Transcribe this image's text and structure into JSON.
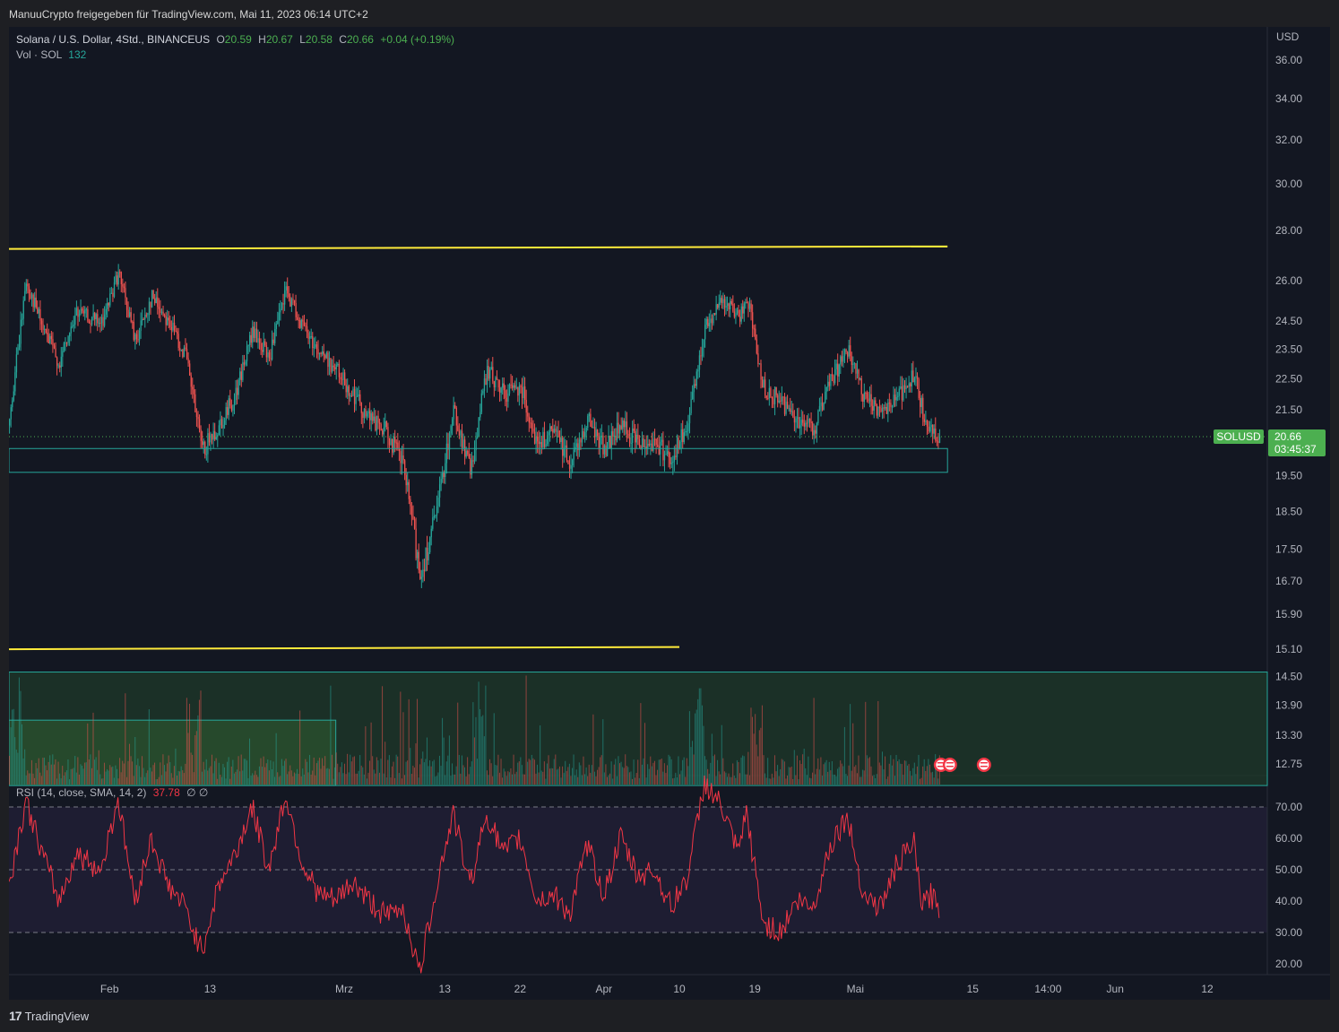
{
  "header": {
    "publish_line": "ManuuCrypto freigegeben für TradingView.com, Mai 11, 2023 06:14 UTC+2"
  },
  "legend": {
    "symbol": "Solana / U.S. Dollar, 4Std., BINANCEUS",
    "o_label": "O",
    "o_value": "20.59",
    "h_label": "H",
    "h_value": "20.67",
    "l_label": "L",
    "l_value": "20.58",
    "c_label": "C",
    "c_value": "20.66",
    "change": "+0.04 (+0.19%)",
    "vol_label": "Vol · SOL",
    "vol_value": "132"
  },
  "rsi_legend": {
    "label": "RSI (14, close, SMA, 14, 2)",
    "value": "37.78",
    "extra": "∅  ∅"
  },
  "price_badge": {
    "symbol": "SOLUSD",
    "price": "20.66",
    "countdown": "03:45:37"
  },
  "footer": {
    "brand": "TradingView"
  },
  "colors": {
    "up": "#26a69a",
    "down": "#ef5350",
    "yellow": "#ffeb3b",
    "rsi": "#f23645",
    "badge": "#4caf50"
  },
  "chart_data": {
    "type": "candlestick",
    "symbol": "Solana / U.S. Dollar",
    "timeframe": "4Std.",
    "exchange": "BINANCEUS",
    "currency": "USD",
    "scale": "log",
    "price_axis_ticks": [
      "36.00",
      "34.00",
      "32.00",
      "30.00",
      "28.00",
      "26.00",
      "24.50",
      "23.50",
      "22.50",
      "21.50",
      "19.50",
      "18.50",
      "17.50",
      "16.70",
      "15.90",
      "15.10",
      "14.50",
      "13.90",
      "13.30",
      "12.75"
    ],
    "rsi_axis_ticks": [
      "70.00",
      "60.00",
      "50.00",
      "40.00",
      "30.00",
      "20.00"
    ],
    "time_axis_ticks": [
      "Feb",
      "13",
      "Mrz",
      "13",
      "22",
      "Apr",
      "10",
      "19",
      "Mai",
      "15",
      "14:00",
      "Jun",
      "12"
    ],
    "last_price": 20.66,
    "path_points": [
      {
        "date": "2023-01-20",
        "price": 21.0
      },
      {
        "date": "2023-01-22",
        "price": 26.0
      },
      {
        "date": "2023-01-24",
        "price": 24.2
      },
      {
        "date": "2023-01-26",
        "price": 23.0
      },
      {
        "date": "2023-01-28",
        "price": 24.8
      },
      {
        "date": "2023-01-31",
        "price": 24.4
      },
      {
        "date": "2023-02-02",
        "price": 26.3
      },
      {
        "date": "2023-02-04",
        "price": 23.8
      },
      {
        "date": "2023-02-06",
        "price": 25.4
      },
      {
        "date": "2023-02-08",
        "price": 24.5
      },
      {
        "date": "2023-02-10",
        "price": 23.3
      },
      {
        "date": "2023-02-12",
        "price": 20.2
      },
      {
        "date": "2023-02-14",
        "price": 21.0
      },
      {
        "date": "2023-02-16",
        "price": 22.0
      },
      {
        "date": "2023-02-18",
        "price": 24.1
      },
      {
        "date": "2023-02-20",
        "price": 23.2
      },
      {
        "date": "2023-02-22",
        "price": 25.6
      },
      {
        "date": "2023-02-24",
        "price": 24.3
      },
      {
        "date": "2023-02-26",
        "price": 23.4
      },
      {
        "date": "2023-02-28",
        "price": 22.8
      },
      {
        "date": "2023-03-02",
        "price": 22.0
      },
      {
        "date": "2023-03-04",
        "price": 21.2
      },
      {
        "date": "2023-03-06",
        "price": 20.8
      },
      {
        "date": "2023-03-08",
        "price": 19.8
      },
      {
        "date": "2023-03-10",
        "price": 16.8
      },
      {
        "date": "2023-03-12",
        "price": 18.5
      },
      {
        "date": "2023-03-14",
        "price": 21.5
      },
      {
        "date": "2023-03-16",
        "price": 19.6
      },
      {
        "date": "2023-03-18",
        "price": 22.8
      },
      {
        "date": "2023-03-20",
        "price": 22.0
      },
      {
        "date": "2023-03-22",
        "price": 22.3
      },
      {
        "date": "2023-03-24",
        "price": 20.4
      },
      {
        "date": "2023-03-26",
        "price": 20.8
      },
      {
        "date": "2023-03-28",
        "price": 19.9
      },
      {
        "date": "2023-03-30",
        "price": 21.2
      },
      {
        "date": "2023-04-01",
        "price": 20.3
      },
      {
        "date": "2023-04-03",
        "price": 21.0
      },
      {
        "date": "2023-04-05",
        "price": 20.5
      },
      {
        "date": "2023-04-07",
        "price": 20.5
      },
      {
        "date": "2023-04-09",
        "price": 20.0
      },
      {
        "date": "2023-04-11",
        "price": 21.0
      },
      {
        "date": "2023-04-13",
        "price": 24.3
      },
      {
        "date": "2023-04-15",
        "price": 25.3
      },
      {
        "date": "2023-04-17",
        "price": 24.6
      },
      {
        "date": "2023-04-18",
        "price": 25.4
      },
      {
        "date": "2023-04-20",
        "price": 22.2
      },
      {
        "date": "2023-04-22",
        "price": 21.8
      },
      {
        "date": "2023-04-24",
        "price": 21.2
      },
      {
        "date": "2023-04-26",
        "price": 20.9
      },
      {
        "date": "2023-04-28",
        "price": 22.4
      },
      {
        "date": "2023-04-30",
        "price": 23.5
      },
      {
        "date": "2023-05-02",
        "price": 21.8
      },
      {
        "date": "2023-05-04",
        "price": 21.5
      },
      {
        "date": "2023-05-06",
        "price": 21.9
      },
      {
        "date": "2023-05-08",
        "price": 22.6
      },
      {
        "date": "2023-05-09",
        "price": 21.4
      },
      {
        "date": "2023-05-10",
        "price": 20.8
      },
      {
        "date": "2023-05-11",
        "price": 20.66
      }
    ],
    "rsi_points": [
      {
        "date": "2023-01-20",
        "value": 45
      },
      {
        "date": "2023-01-22",
        "value": 72
      },
      {
        "date": "2023-01-24",
        "value": 55
      },
      {
        "date": "2023-01-26",
        "value": 40
      },
      {
        "date": "2023-01-28",
        "value": 55
      },
      {
        "date": "2023-01-31",
        "value": 50
      },
      {
        "date": "2023-02-02",
        "value": 73
      },
      {
        "date": "2023-02-04",
        "value": 40
      },
      {
        "date": "2023-02-06",
        "value": 60
      },
      {
        "date": "2023-02-08",
        "value": 45
      },
      {
        "date": "2023-02-10",
        "value": 38
      },
      {
        "date": "2023-02-12",
        "value": 24
      },
      {
        "date": "2023-02-14",
        "value": 45
      },
      {
        "date": "2023-02-16",
        "value": 55
      },
      {
        "date": "2023-02-18",
        "value": 70
      },
      {
        "date": "2023-02-20",
        "value": 50
      },
      {
        "date": "2023-02-22",
        "value": 74
      },
      {
        "date": "2023-02-24",
        "value": 52
      },
      {
        "date": "2023-02-26",
        "value": 42
      },
      {
        "date": "2023-02-28",
        "value": 40
      },
      {
        "date": "2023-03-02",
        "value": 46
      },
      {
        "date": "2023-03-04",
        "value": 40
      },
      {
        "date": "2023-03-06",
        "value": 35
      },
      {
        "date": "2023-03-08",
        "value": 38
      },
      {
        "date": "2023-03-10",
        "value": 17
      },
      {
        "date": "2023-03-12",
        "value": 45
      },
      {
        "date": "2023-03-14",
        "value": 68
      },
      {
        "date": "2023-03-16",
        "value": 45
      },
      {
        "date": "2023-03-18",
        "value": 68
      },
      {
        "date": "2023-03-20",
        "value": 55
      },
      {
        "date": "2023-03-22",
        "value": 60
      },
      {
        "date": "2023-03-24",
        "value": 40
      },
      {
        "date": "2023-03-26",
        "value": 42
      },
      {
        "date": "2023-03-28",
        "value": 36
      },
      {
        "date": "2023-03-30",
        "value": 58
      },
      {
        "date": "2023-04-01",
        "value": 42
      },
      {
        "date": "2023-04-03",
        "value": 60
      },
      {
        "date": "2023-04-05",
        "value": 48
      },
      {
        "date": "2023-04-07",
        "value": 50
      },
      {
        "date": "2023-04-09",
        "value": 38
      },
      {
        "date": "2023-04-11",
        "value": 48
      },
      {
        "date": "2023-04-13",
        "value": 78
      },
      {
        "date": "2023-04-15",
        "value": 70
      },
      {
        "date": "2023-04-17",
        "value": 55
      },
      {
        "date": "2023-04-18",
        "value": 68
      },
      {
        "date": "2023-04-20",
        "value": 33
      },
      {
        "date": "2023-04-22",
        "value": 30
      },
      {
        "date": "2023-04-24",
        "value": 40
      },
      {
        "date": "2023-04-26",
        "value": 38
      },
      {
        "date": "2023-04-28",
        "value": 58
      },
      {
        "date": "2023-04-30",
        "value": 67
      },
      {
        "date": "2023-05-02",
        "value": 42
      },
      {
        "date": "2023-05-04",
        "value": 38
      },
      {
        "date": "2023-05-06",
        "value": 52
      },
      {
        "date": "2023-05-08",
        "value": 58
      },
      {
        "date": "2023-05-09",
        "value": 38
      },
      {
        "date": "2023-05-10",
        "value": 42
      },
      {
        "date": "2023-05-11",
        "value": 37.78
      }
    ],
    "annotations": {
      "upper_trendline": {
        "start": {
          "date": "2023-01-20",
          "price": 27.25
        },
        "end": {
          "date": "2023-05-12",
          "price": 27.35
        }
      },
      "lower_trendline": {
        "start": {
          "date": "2023-01-20",
          "price": 15.1
        },
        "end": {
          "date": "2023-04-10",
          "price": 15.15
        }
      },
      "support_zone": {
        "top": 20.3,
        "bottom": 19.6,
        "start": "2023-01-20",
        "end": "2023-05-12"
      },
      "volume_profile_box": {
        "top": 14.6,
        "bottom": 12.35,
        "start": "2023-01-20"
      },
      "volume_inner_box": {
        "top": 13.6,
        "bottom": 12.35,
        "start": "2023-01-20",
        "end": "2023-02-28"
      }
    }
  }
}
